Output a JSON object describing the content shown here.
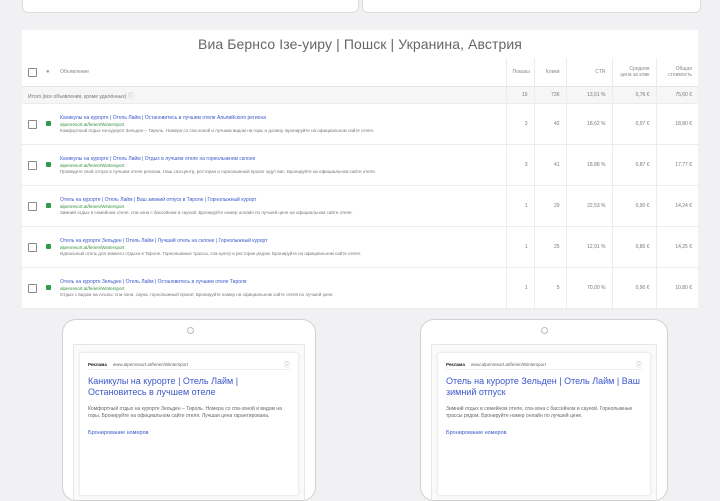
{
  "report": {
    "title": "Виа Бернсо Ізе-уиру | Пошск | Укранина, Австрия"
  },
  "table": {
    "headers": [
      "Объявление",
      "Показы",
      "Клики",
      "CTR",
      "Средняя цена за клик",
      "Общая стоимость"
    ],
    "summary": {
      "label": "Итого (все объявления, кроме удалённых)",
      "values": [
        "15",
        "736",
        "13,51 %",
        "0,76 €",
        "75,60 €"
      ]
    },
    "rows": [
      {
        "headline": "Каникулы на курорте | Отель Лайм | Остановитесь в лучшем отеле Альпийского региона",
        "url": "alpenresort.at/ferien/Wintersport",
        "desc": "Комфортный отдых на курорте Зельден – Тироль. Номера со спа-зоной и лучшим видом на горы и долину. Бронируйте на официальном сайте отеля.",
        "values": [
          "3",
          "42",
          "18,62 %",
          "0,97 €",
          "18,80 €"
        ]
      },
      {
        "headline": "Каникулы на курорте | Отель Лайм | Отдых в лучшем отеле на горнолыжном склоне",
        "url": "alpenresort.at/ferien/Wintersport",
        "desc": "Проведите свой отпуск в лучшем отеле региона. Наш спа-центр, ресторан и горнолыжный прокат ждут вас. Бронируйте на официальном сайте отеля.",
        "values": [
          "3",
          "41",
          "18,88 %",
          "0,87 €",
          "17,77 €"
        ]
      },
      {
        "headline": "Отель на курорте | Отель Лайм | Ваш зимний отпуск в Тироле | Горнолыжный курорт",
        "url": "alpenresort.at/ferien/Wintersport",
        "desc": "Зимний отдых в семейном отеле, спа-зона с бассейном и сауной. Бронируйте номер онлайн по лучшей цене на официальном сайте отеля.",
        "values": [
          "1",
          "29",
          "22,53 %",
          "0,90 €",
          "14,24 €"
        ]
      },
      {
        "headline": "Отель на курорте Зельден | Отель Лайм | Лучший отель на склоне | Горнолыжный курорт",
        "url": "alpenresort.at/ferien/Wintersport",
        "desc": "Идеальный отель для зимнего отдыха в Тироле. Горнолыжные трассы, спа-центр и ресторан рядом. Бронируйте на официальном сайте отеля.",
        "values": [
          "1",
          "25",
          "12,91 %",
          "0,80 €",
          "14,25 €"
        ]
      },
      {
        "headline": "Отель на курорте Зельден | Отель Лайм | Остановитесь в лучшем отеле Тироля",
        "url": "alpenresort.at/ferien/Wintersport",
        "desc": "Отдых с видом на Альпы: спа-зона, сауна, горнолыжный прокат. Бронируйте номер на официальном сайте отеля по лучшей цене.",
        "values": [
          "1",
          "5",
          "70,00 %",
          "0,90 €",
          "10,80 €"
        ]
      }
    ]
  },
  "phones": [
    {
      "ad_label": "Реклама",
      "url": "www.alpenresort.at/ferien/Wintersport",
      "title": "Каникулы на курорте | Отель Лайм | Остановитесь в лучшем отеле",
      "desc": "Комфортный отдых на курорте Зельден – Тироль. Номера со спа-зоной и видом на горы. Бронируйте на официальном сайте отеля. Лучшая цена гарантирована.",
      "link": "Бронирование номеров"
    },
    {
      "ad_label": "Реклама",
      "url": "www.alpenresort.at/ferien/Wintersport",
      "title": "Отель на курорте Зельден | Отель Лайм | Ваш зимний отпуск",
      "desc": "Зимний отдых в семейном отеле, спа-зона с бассейном и сауной. Горнолыжные трассы рядом. Бронируйте номер онлайн по лучшей цене.",
      "link": "Бронирование номеров"
    }
  ]
}
